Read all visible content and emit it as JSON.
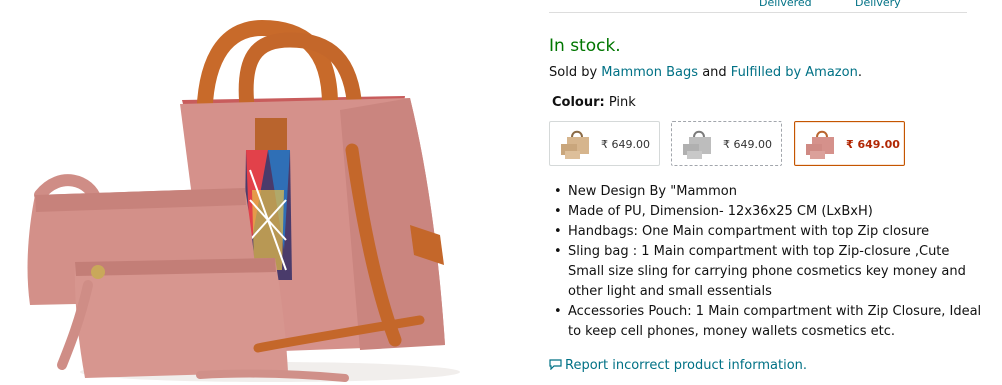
{
  "top_row": {
    "labels": [
      "Delivered",
      "Delivery"
    ]
  },
  "availability": {
    "text": "In stock."
  },
  "seller": {
    "prefix": "Sold by",
    "seller_name": "Mammon Bags",
    "middle": "and",
    "fulfilled": "Fulfilled by Amazon",
    "suffix": "."
  },
  "colour": {
    "label": "Colour:",
    "value": "Pink"
  },
  "variants": [
    {
      "price": "₹ 649.00",
      "name": "Beige",
      "selected": false
    },
    {
      "price": "₹ 649.00",
      "name": "Grey",
      "selected": false
    },
    {
      "price": "₹ 649.00",
      "name": "Pink",
      "selected": true
    }
  ],
  "bullets": [
    "New Design By \"Mammon",
    "Made of PU, Dimension- 12x36x25 CM (LxBxH)",
    "Handbags: One Main compartment with top Zip closure",
    "Sling bag : 1 Main compartment with top Zip-closure ,Cute Small size sling for carrying phone cosmetics key money and other light and small essentials",
    "Accessories Pouch: 1 Main compartment with Zip Closure, Ideal to keep cell phones, money wallets cosmetics etc."
  ],
  "report_link": {
    "icon": "speech-bubble-icon",
    "text": "Report incorrect product information."
  },
  "colors": {
    "link": "#007185",
    "stock": "#007600",
    "price_selected": "#b12704",
    "selected_border": "#c45500"
  }
}
